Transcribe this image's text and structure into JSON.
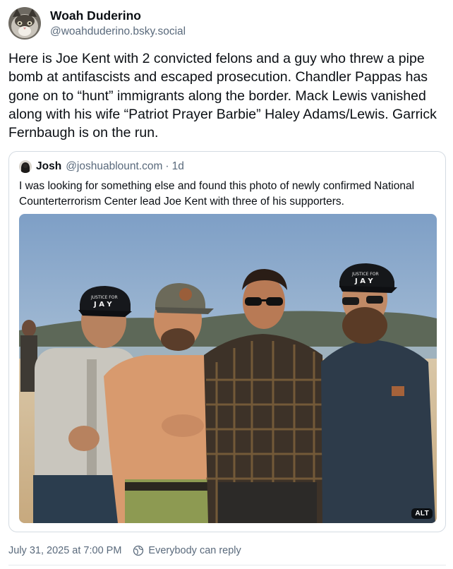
{
  "post": {
    "author": {
      "display_name": "Woah Duderino",
      "handle": "@woahduderino.bsky.social",
      "avatar_icon": "cat-avatar-icon"
    },
    "text": "Here is Joe Kent with 2 convicted felons and a guy who threw a pipe bomb at antifascists and escaped prosecution. Chandler Pappas has gone on to “hunt” immigrants along the border. Mack Lewis vanished along with his wife “Patriot Prayer Barbie” Haley Adams/Lewis. Garrick Fernbaugh is on the run.",
    "quote": {
      "author_name": "Josh",
      "author_handle": "@joshuablount.com",
      "separator": "·",
      "time": "1d",
      "text": "I was looking for something else and found this photo of newly confirmed National Counterterrorism Center lead Joe Kent with three of his supporters.",
      "image": {
        "alt_badge": "ALT",
        "hat_text_left": "JUSTICE FOR J A Y",
        "hat_text_right": "JUSTICE FOR J A Y"
      }
    },
    "footer": {
      "timestamp": "July 31, 2025 at 7:00 PM",
      "reply_setting": "Everybody can reply",
      "reply_icon": "globe-reply-icon"
    }
  },
  "colors": {
    "text_primary": "#0b0f14",
    "text_secondary": "#5a6a7c",
    "border": "#d4dbe2"
  }
}
